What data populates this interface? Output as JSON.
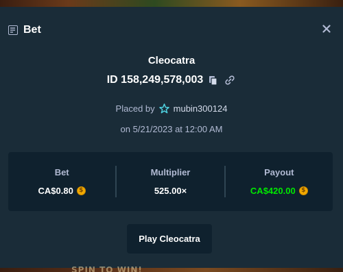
{
  "header": {
    "title": "Bet",
    "icon": "bet-slip-icon",
    "close_icon": "close-icon"
  },
  "bet": {
    "game_name": "Cleocatra",
    "id_label": "ID 158,249,578,003",
    "placed_by_prefix": "Placed by",
    "username": "mubin300124",
    "date_text": "on 5/21/2023 at 12:00 AM"
  },
  "stats": {
    "bet_label": "Bet",
    "bet_value": "CA$0.80",
    "multiplier_label": "Multiplier",
    "multiplier_value": "525.00×",
    "payout_label": "Payout",
    "payout_value": "CA$420.00"
  },
  "actions": {
    "play_label": "Play Cleocatra"
  },
  "background": {
    "bottom_text": "SPIN TO WIN!"
  },
  "colors": {
    "modal_bg": "#1a2c38",
    "panel_bg": "#0f212e",
    "payout_green": "#00e701",
    "muted_text": "#b1bad3",
    "coin": "#f2a900",
    "vip_star": "#4fd1e0"
  }
}
